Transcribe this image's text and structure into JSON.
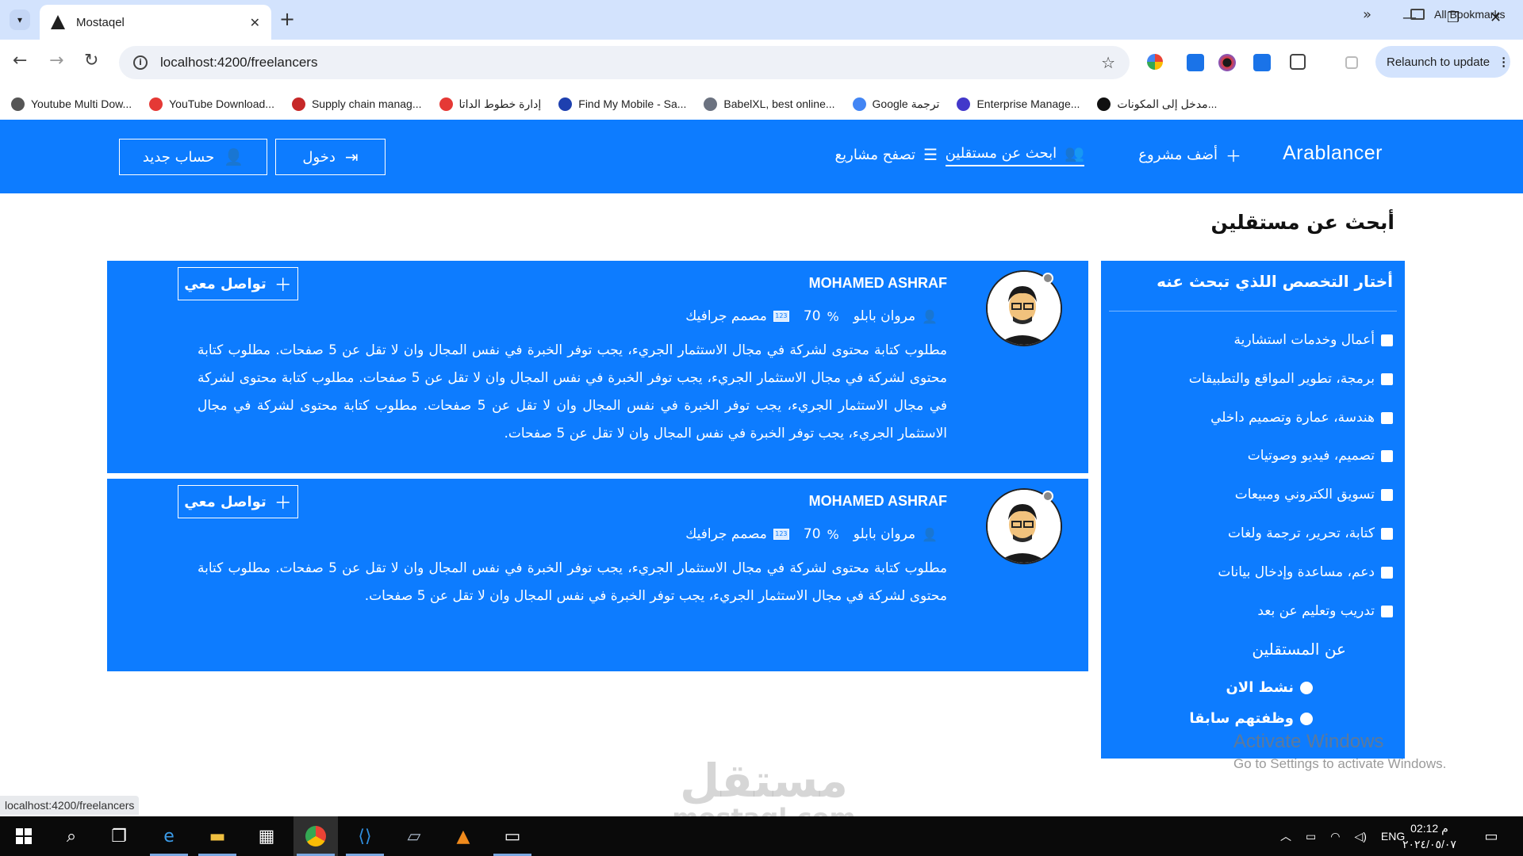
{
  "browser": {
    "tab_title": "Mostaqel",
    "url": "localhost:4200/freelancers",
    "relaunch_label": "Relaunch to update",
    "bookmarks": [
      {
        "label": "Youtube Multi Dow...",
        "color": "#555555"
      },
      {
        "label": "YouTube Download...",
        "color": "#e53935"
      },
      {
        "label": "Supply chain manag...",
        "color": "#c62828"
      },
      {
        "label": "إدارة خطوط الداتا",
        "color": "#e53935"
      },
      {
        "label": "Find My Mobile - Sa...",
        "color": "#1e40af"
      },
      {
        "label": "BabelXL, best online...",
        "color": "#6b7280"
      },
      {
        "label": "Google ترجمة",
        "color": "#4285f4"
      },
      {
        "label": "Enterprise Manage...",
        "color": "#4338ca"
      },
      {
        "label": "مدخل إلى المكونات...",
        "color": "#111111"
      }
    ],
    "all_bookmarks": "All Bookmarks",
    "status_url": "localhost:4200/freelancers"
  },
  "nav": {
    "brand": "Arablancer",
    "add_project": "أضف مشروع",
    "find_freelancers": "ابحث عن مستقلين",
    "browse_projects": "تصفح مشاريع",
    "login": "دخول",
    "new_account": "حساب جديد"
  },
  "page": {
    "title": "أبحث عن مستقلين"
  },
  "filter": {
    "title": "أختار التخصص اللذي تبحث عنه",
    "categories": [
      "أعمال وخدمات استشارية",
      "برمجة، تطوير المواقع والتطبيقات",
      "هندسة، عمارة وتصميم داخلي",
      "تصميم، فيديو وصوتيات",
      "تسويق الكتروني ومبيعات",
      "كتابة، تحرير، ترجمة ولغات",
      "دعم، مساعدة وإدخال بيانات",
      "تدريب وتعليم عن بعد"
    ],
    "about_title": "عن المستقلين",
    "statuses": [
      "نشط الان",
      "وظفتهم سابقا"
    ]
  },
  "cards": [
    {
      "name": "MOHAMED ASHRAF",
      "user": "مروان بابلو",
      "rating": "70",
      "role": "مصمم جرافيك",
      "contact_label": "تواصل معي",
      "description": "مطلوب كتابة محتوى لشركة في مجال الاستثمار الجريء، يجب توفر الخبرة في نفس المجال وان لا تقل عن 5 صفحات. مطلوب كتابة محتوى لشركة في مجال الاستثمار الجريء، يجب توفر الخبرة في نفس المجال وان لا تقل عن 5 صفحات. مطلوب كتابة محتوى لشركة في مجال الاستثمار الجريء، يجب توفر الخبرة في نفس المجال وان لا تقل عن 5 صفحات. مطلوب كتابة محتوى لشركة في مجال الاستثمار الجريء، يجب توفر الخبرة في نفس المجال وان لا تقل عن 5 صفحات."
    },
    {
      "name": "MOHAMED ASHRAF",
      "user": "مروان بابلو",
      "rating": "70",
      "role": "مصمم جرافيك",
      "contact_label": "تواصل معي",
      "description": "مطلوب كتابة محتوى لشركة في مجال الاستثمار الجريء، يجب توفر الخبرة في نفس المجال وان لا تقل عن 5 صفحات. مطلوب كتابة محتوى لشركة في مجال الاستثمار الجريء، يجب توفر الخبرة في نفس المجال وان لا تقل عن 5 صفحات."
    }
  ],
  "os": {
    "activate_title": "Activate Windows",
    "activate_sub": "Go to Settings to activate Windows.",
    "watermark_ar": "مستقل",
    "watermark_en": "mostaql.com",
    "lang": "ENG",
    "time": "02:12 م",
    "date": "٢٠٢٤/٠٥/٠٧"
  },
  "colors": {
    "brand_blue": "#0d7cff",
    "chrome_tab": "#d3e3fd"
  }
}
